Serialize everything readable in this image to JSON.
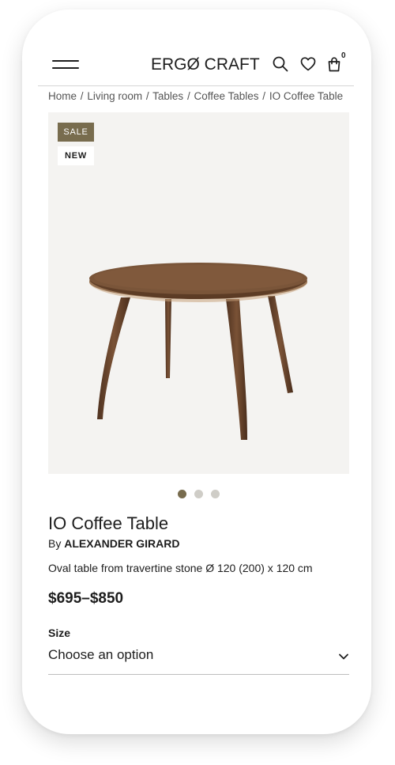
{
  "header": {
    "logo": "ERGØ CRAFT",
    "cart_count": "0"
  },
  "breadcrumb": {
    "items": [
      "Home",
      "Living room",
      "Tables",
      "Coffee Tables"
    ],
    "current": "IO Coffee Table",
    "separator": "/"
  },
  "gallery": {
    "badges": {
      "sale": "SALE",
      "new": "NEW"
    },
    "slide_count": 3,
    "active_slide": 1
  },
  "product": {
    "title": "IO Coffee Table",
    "by_prefix": "By",
    "author": "ALEXANDER GIRARD",
    "description": "Oval table from travertine stone Ø 120 (200) x 120 cm",
    "price": "$695–$850"
  },
  "options": {
    "size_label": "Size",
    "size_value": "Choose an option"
  },
  "colors": {
    "accent": "#786c4e",
    "dot_inactive": "#cfcdc7",
    "image_bg": "#f4f3f1",
    "text": "#1d1d1d"
  },
  "icons": {
    "menu": "menu-icon",
    "search": "search-icon",
    "wishlist": "heart-icon",
    "cart": "bag-icon",
    "dropdown": "chevron-down-icon"
  }
}
